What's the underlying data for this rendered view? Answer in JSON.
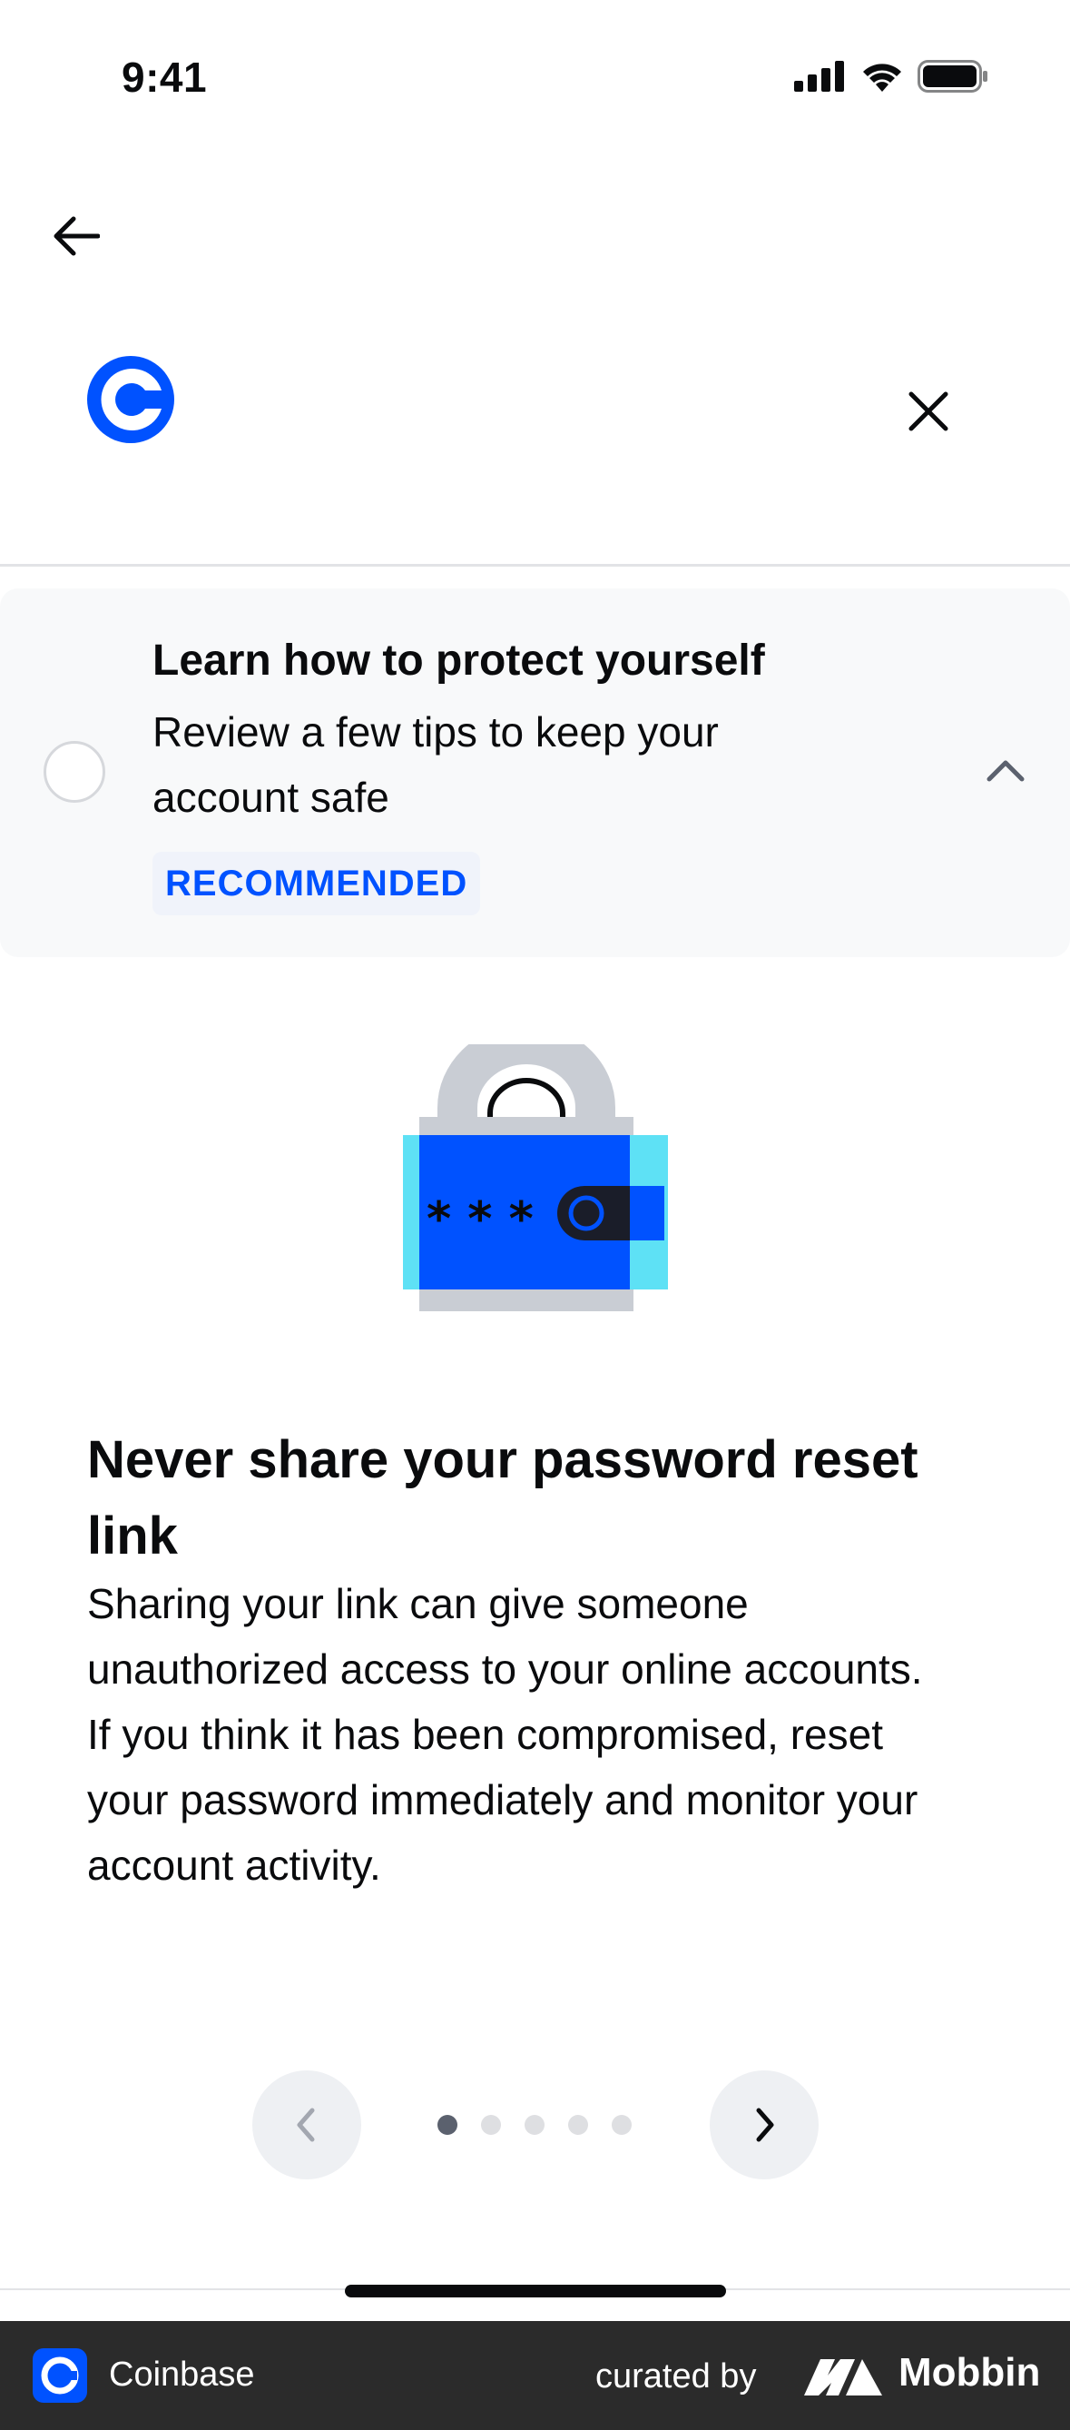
{
  "status_bar": {
    "time": "9:41"
  },
  "task": {
    "title": "Learn how to protect yourself",
    "description": "Review a few tips to keep your account safe",
    "badge": "RECOMMENDED"
  },
  "tip": {
    "heading": "Never share your password reset link",
    "body": "Sharing your link can give someone unauthorized access to your online accounts. If you think it has been compromised, reset your password immediately and monitor your account activity.",
    "illustration_text": "* * *"
  },
  "pager": {
    "total": 5,
    "current": 1
  },
  "footer": {
    "app_name": "Coinbase",
    "curated_by": "curated by",
    "brand": "Mobbin"
  },
  "colors": {
    "accent": "#0052ff",
    "text": "#0a0b0d",
    "card_bg": "#f8f9fa"
  }
}
